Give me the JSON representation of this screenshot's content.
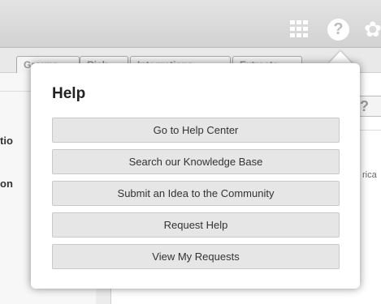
{
  "header": {
    "help_glyph": "?",
    "gear_glyph": "✿"
  },
  "background": {
    "tabs": [
      "Groups",
      "Risk",
      "Integrations",
      "Extracts"
    ],
    "left_labels": [
      "tio",
      "on"
    ],
    "right_fragment": "rica",
    "help_glyph": "?"
  },
  "help_popover": {
    "title": "Help",
    "items": [
      {
        "label": "Go to Help Center"
      },
      {
        "label": "Search our Knowledge Base"
      },
      {
        "label": "Submit an Idea to the Community"
      },
      {
        "label": "Request Help"
      },
      {
        "label": "View My Requests"
      }
    ]
  }
}
